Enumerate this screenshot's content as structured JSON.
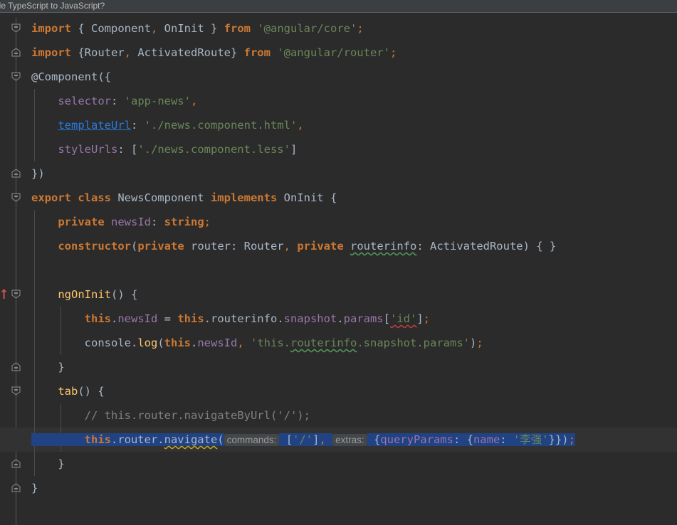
{
  "notification": {
    "text": "ile TypeScript to JavaScript?"
  },
  "colors": {
    "editor_background": "#2b2b2b",
    "current_line_background": "#323232",
    "selection_background": "#214283",
    "keyword": "#cc7832",
    "string": "#6a8759",
    "field": "#9876aa",
    "method": "#ffc66d",
    "comment": "#808080",
    "default_text": "#a9b7c6",
    "link": "#287bde",
    "gutter_fold_line": "#555a5c",
    "notification_background": "#3c3f41"
  },
  "editor": {
    "language": "TypeScript",
    "lines": [
      {
        "n": 1,
        "tokens": [
          {
            "t": "import",
            "c": "kw"
          },
          {
            "t": " { Component",
            "c": "plain"
          },
          {
            "t": ",",
            "c": "op"
          },
          {
            "t": " OnInit } ",
            "c": "plain"
          },
          {
            "t": "from",
            "c": "kw"
          },
          {
            "t": " ",
            "c": "plain"
          },
          {
            "t": "'@angular/core'",
            "c": "str"
          },
          {
            "t": ";",
            "c": "op"
          }
        ]
      },
      {
        "n": 2,
        "tokens": [
          {
            "t": "import",
            "c": "kw"
          },
          {
            "t": " {Router",
            "c": "plain"
          },
          {
            "t": ",",
            "c": "op"
          },
          {
            "t": " ActivatedRoute} ",
            "c": "plain"
          },
          {
            "t": "from",
            "c": "kw"
          },
          {
            "t": " ",
            "c": "plain"
          },
          {
            "t": "'@angular/router'",
            "c": "str"
          },
          {
            "t": ";",
            "c": "op"
          }
        ]
      },
      {
        "n": 3,
        "tokens": [
          {
            "t": "@Component({",
            "c": "plain"
          }
        ]
      },
      {
        "n": 4,
        "tokens": [
          {
            "t": "    selector",
            "c": "field"
          },
          {
            "t": ": ",
            "c": "plain"
          },
          {
            "t": "'app-news'",
            "c": "str"
          },
          {
            "t": ",",
            "c": "op"
          }
        ]
      },
      {
        "n": 5,
        "tokens": [
          {
            "t": "    ",
            "c": "plain"
          },
          {
            "t": "templateUrl",
            "c": "lnk"
          },
          {
            "t": ": ",
            "c": "plain"
          },
          {
            "t": "'./news.component.html'",
            "c": "str"
          },
          {
            "t": ",",
            "c": "op"
          }
        ]
      },
      {
        "n": 6,
        "tokens": [
          {
            "t": "    styleUrls",
            "c": "field"
          },
          {
            "t": ": [",
            "c": "plain"
          },
          {
            "t": "'./news.component.less'",
            "c": "str"
          },
          {
            "t": "]",
            "c": "plain"
          }
        ]
      },
      {
        "n": 7,
        "tokens": [
          {
            "t": "})",
            "c": "plain"
          }
        ]
      },
      {
        "n": 8,
        "tokens": [
          {
            "t": "export class",
            "c": "kw"
          },
          {
            "t": " NewsComponent ",
            "c": "plain"
          },
          {
            "t": "implements",
            "c": "kw"
          },
          {
            "t": " OnInit {",
            "c": "plain"
          }
        ]
      },
      {
        "n": 9,
        "tokens": [
          {
            "t": "    ",
            "c": "plain"
          },
          {
            "t": "private",
            "c": "kw"
          },
          {
            "t": " ",
            "c": "plain"
          },
          {
            "t": "newsId",
            "c": "field"
          },
          {
            "t": ": ",
            "c": "plain"
          },
          {
            "t": "string",
            "c": "kw"
          },
          {
            "t": ";",
            "c": "op"
          }
        ]
      },
      {
        "n": 10,
        "tokens": [
          {
            "t": "    ",
            "c": "plain"
          },
          {
            "t": "constructor",
            "c": "kw"
          },
          {
            "t": "(",
            "c": "plain"
          },
          {
            "t": "private",
            "c": "kw"
          },
          {
            "t": " router: Router",
            "c": "plain"
          },
          {
            "t": ",",
            "c": "op"
          },
          {
            "t": " ",
            "c": "plain"
          },
          {
            "t": "private",
            "c": "kw"
          },
          {
            "t": " ",
            "c": "plain"
          },
          {
            "t": "routerinfo",
            "c": "plain sq-green"
          },
          {
            "t": ": ActivatedRoute) { }",
            "c": "plain"
          }
        ]
      },
      {
        "n": 11,
        "tokens": []
      },
      {
        "n": 12,
        "tokens": [
          {
            "t": "    ",
            "c": "plain"
          },
          {
            "t": "ngOnInit",
            "c": "meth"
          },
          {
            "t": "() {",
            "c": "plain"
          }
        ],
        "gutter_icon": "override-method-icon"
      },
      {
        "n": 13,
        "tokens": [
          {
            "t": "        ",
            "c": "plain"
          },
          {
            "t": "this",
            "c": "kw"
          },
          {
            "t": ".",
            "c": "plain"
          },
          {
            "t": "newsId",
            "c": "field"
          },
          {
            "t": " = ",
            "c": "plain"
          },
          {
            "t": "this",
            "c": "kw"
          },
          {
            "t": ".routerinfo.",
            "c": "plain"
          },
          {
            "t": "snapshot",
            "c": "field"
          },
          {
            "t": ".",
            "c": "plain"
          },
          {
            "t": "params",
            "c": "field"
          },
          {
            "t": "[",
            "c": "plain"
          },
          {
            "t": "'id'",
            "c": "str sq-red"
          },
          {
            "t": "]",
            "c": "plain"
          },
          {
            "t": ";",
            "c": "op"
          }
        ]
      },
      {
        "n": 14,
        "tokens": [
          {
            "t": "        console.",
            "c": "plain"
          },
          {
            "t": "log",
            "c": "meth"
          },
          {
            "t": "(",
            "c": "plain"
          },
          {
            "t": "this",
            "c": "kw"
          },
          {
            "t": ".",
            "c": "plain"
          },
          {
            "t": "newsId",
            "c": "field"
          },
          {
            "t": ",",
            "c": "op"
          },
          {
            "t": " ",
            "c": "plain"
          },
          {
            "t": "'this.",
            "c": "str"
          },
          {
            "t": "routerinfo",
            "c": "str sq-green"
          },
          {
            "t": ".snapshot.params'",
            "c": "str"
          },
          {
            "t": ")",
            "c": "plain"
          },
          {
            "t": ";",
            "c": "op"
          }
        ]
      },
      {
        "n": 15,
        "tokens": [
          {
            "t": "    }",
            "c": "plain"
          }
        ]
      },
      {
        "n": 16,
        "tokens": [
          {
            "t": "    ",
            "c": "plain"
          },
          {
            "t": "tab",
            "c": "meth"
          },
          {
            "t": "() {",
            "c": "plain"
          }
        ]
      },
      {
        "n": 17,
        "tokens": [
          {
            "t": "        // this.router.navigateByUrl('/');",
            "c": "cmt"
          }
        ]
      },
      {
        "n": 18,
        "selected": true,
        "current": true,
        "tokens": [
          {
            "t": "        ",
            "c": "plain"
          },
          {
            "t": "this",
            "c": "kw"
          },
          {
            "t": ".router.",
            "c": "plain"
          },
          {
            "t": "navigate",
            "c": "plain sq-yellow"
          },
          {
            "t": "(",
            "c": "plain"
          },
          {
            "t": "commands:",
            "c": "hint"
          },
          {
            "t": " [",
            "c": "plain"
          },
          {
            "t": "'/'",
            "c": "str"
          },
          {
            "t": "]",
            "c": "plain"
          },
          {
            "t": ",",
            "c": "op"
          },
          {
            "t": " ",
            "c": "plain"
          },
          {
            "t": "extras:",
            "c": "hint"
          },
          {
            "t": " {",
            "c": "plain"
          },
          {
            "t": "queryParams",
            "c": "field"
          },
          {
            "t": ": {",
            "c": "plain"
          },
          {
            "t": "name",
            "c": "field"
          },
          {
            "t": ": ",
            "c": "plain"
          },
          {
            "t": "'李强'",
            "c": "str"
          },
          {
            "t": "}})",
            "c": "plain"
          },
          {
            "t": ";",
            "c": "op"
          }
        ]
      },
      {
        "n": 19,
        "tokens": [
          {
            "t": "    }",
            "c": "plain"
          }
        ]
      },
      {
        "n": 20,
        "tokens": [
          {
            "t": "}",
            "c": "plain"
          }
        ]
      }
    ]
  },
  "gutter": {
    "fold_markers": [
      {
        "line": 1,
        "kind": "fold-start"
      },
      {
        "line": 2,
        "kind": "fold-end"
      },
      {
        "line": 3,
        "kind": "fold-start"
      },
      {
        "line": 7,
        "kind": "fold-end"
      },
      {
        "line": 8,
        "kind": "fold-start"
      },
      {
        "line": 12,
        "kind": "fold-start"
      },
      {
        "line": 15,
        "kind": "fold-end"
      },
      {
        "line": 16,
        "kind": "fold-start"
      },
      {
        "line": 19,
        "kind": "fold-end"
      },
      {
        "line": 20,
        "kind": "fold-end"
      }
    ]
  }
}
